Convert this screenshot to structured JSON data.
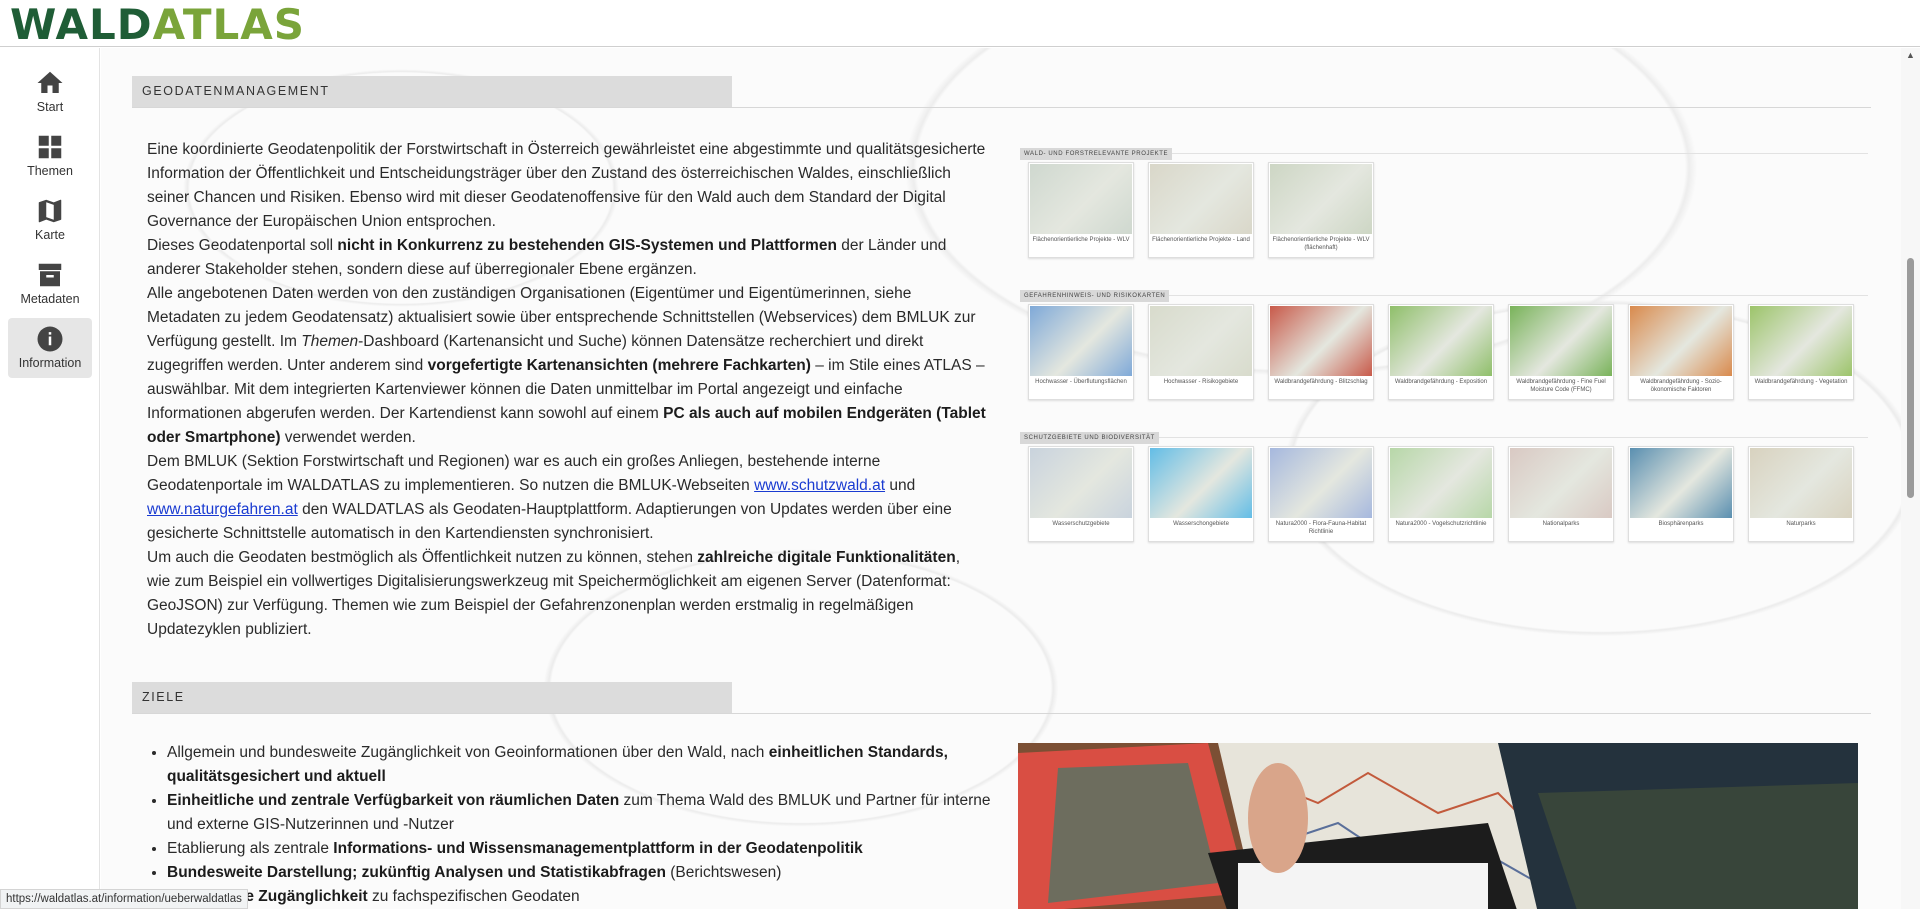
{
  "brand": {
    "logo_part1": "WALD",
    "logo_part2": "ATLAS"
  },
  "sidebar": {
    "items": [
      {
        "label": "Start",
        "icon": "home-icon"
      },
      {
        "label": "Themen",
        "icon": "grid-icon"
      },
      {
        "label": "Karte",
        "icon": "map-icon"
      },
      {
        "label": "Metadaten",
        "icon": "archive-icon"
      },
      {
        "label": "Information",
        "icon": "info-icon",
        "active": true
      }
    ]
  },
  "section1": {
    "title": "GEODATENMANAGEMENT",
    "p1_a": "Eine koordinierte Geodatenpolitik der Forstwirtschaft in Österreich gewährleistet eine abgestimmte und qualitätsgesicherte Information der Öffentlichkeit und Entscheidungsträger über den Zustand des österreichischen Waldes, einschließlich seiner Chancen und Risiken. Ebenso wird mit dieser Geodatenoffensive für den Wald auch dem Standard der Digital Governance der Europäischen Union entsprochen.",
    "p2_a": "Dieses Geodatenportal soll ",
    "p2_b": "nicht in Konkurrenz zu bestehenden GIS-Systemen und Plattformen",
    "p2_c": " der Länder und anderer Stakeholder stehen, sondern diese auf überregionaler Ebene ergänzen.",
    "p3_a": "Alle angebotenen Daten werden von den zuständigen Organisationen (Eigentümer und Eigentümerinnen, siehe Metadaten zu jedem Geodatensatz) aktualisiert sowie über entsprechende Schnittstellen (Webservices) dem BMLUK zur Verfügung gestellt. Im ",
    "p3_em": "Themen",
    "p3_b": "-Dashboard (Kartenansicht und Suche) können Datensätze recherchiert und direkt zugegriffen werden. Unter anderem sind ",
    "p3_c": "vorgefertigte Kartenansichten (mehrere Fachkarten)",
    "p3_d": " – im Stile eines ATLAS – auswählbar. Mit dem integrierten Kartenviewer können die Daten unmittelbar im Portal angezeigt und einfache Informationen abgerufen werden. Der Kartendienst kann sowohl auf einem ",
    "p3_e": "PC als auch auf mobilen Endgeräten (Tablet oder Smartphone)",
    "p3_f": " verwendet werden.",
    "p4_a": "Dem BMLUK (Sektion Forstwirtschaft und Regionen) war es auch ein großes Anliegen, bestehende interne Geodatenportale im WALDATLAS zu implementieren. So nutzen die BMLUK-Webseiten ",
    "p4_link1": "www.schutzwald.at",
    "p4_b": " und ",
    "p4_link2": "www.naturgefahren.at",
    "p4_c": " den WALDATLAS als Geodaten-Hauptplattform. Adaptierungen von Updates werden über eine gesicherte Schnittstelle automatisch in den Kartendiensten synchronisiert.",
    "p5_a": "Um auch die Geodaten bestmöglich als Öffentlichkeit nutzen zu können, stehen ",
    "p5_b": "zahlreiche digitale Funktionalitäten",
    "p5_c": ", wie zum Beispiel ein vollwertiges Digitalisierungswerkzeug mit Speichermöglichkeit am eigenen Server (Datenformat: GeoJSON) zur Verfügung. Themen wie zum Beispiel der Gefahrenzonenplan werden erstmalig in regelmäßigen Updatezyklen publiziert."
  },
  "thumb_groups": [
    {
      "title": "WALD- UND FORSTRELEVANTE PROJEKTE",
      "items": [
        {
          "caption": "Flächenorientierliche Projekte - WLV",
          "color": "#cfd8cf"
        },
        {
          "caption": "Flächenorientierliche Projekte - Land",
          "color": "#d9d7c9"
        },
        {
          "caption": "Flächenorientierliche Projekte - WLV (flächenhaft)",
          "color": "#cdd6c4"
        }
      ]
    },
    {
      "title": "GEFAHRENHINWEIS- UND RISIKOKARTEN",
      "items": [
        {
          "caption": "Hochwasser - Überflutungsflächen",
          "color": "#7fa9d8"
        },
        {
          "caption": "Hochwasser - Risikogebiete",
          "color": "#d8dbcc"
        },
        {
          "caption": "Waldbrandgefährdung - Blitzschlag",
          "color": "#c85a4a"
        },
        {
          "caption": "Waldbrandgefährdung - Exposition",
          "color": "#8fbf6a"
        },
        {
          "caption": "Waldbrandgefährdung - Fine Fuel Moisture Code (FFMC)",
          "color": "#79b35a"
        },
        {
          "caption": "Waldbrandgefährdung - Sozio-ökonomische Faktoren",
          "color": "#d98a4d"
        },
        {
          "caption": "Waldbrandgefährdung - Vegetation",
          "color": "#9cc46a"
        }
      ]
    },
    {
      "title": "SCHUTZGEBIETE UND BIODIVERSITÄT",
      "items": [
        {
          "caption": "Wasserschutzgebiete",
          "color": "#c9d3dd"
        },
        {
          "caption": "Wasserschongebiete",
          "color": "#63bde6"
        },
        {
          "caption": "Natura2000 - Flora-Fauna-Habitat Richtlinie",
          "color": "#a6b8de"
        },
        {
          "caption": "Natura2000 - Vogelschutzrichtlinie",
          "color": "#b7d7a8"
        },
        {
          "caption": "Nationalparks",
          "color": "#d9c9c3"
        },
        {
          "caption": "Biosphärenparks",
          "color": "#5a8fb0"
        },
        {
          "caption": "Naturparks",
          "color": "#d8d2bf"
        }
      ]
    }
  ],
  "section2": {
    "title": "ZIELE",
    "li1_a": "Allgemein und bundesweite Zugänglichkeit von Geoinformationen über den Wald, nach ",
    "li1_b": "einheitlichen Standards, qualitätsgesichert und aktuell",
    "li2_a": "Einheitliche und zentrale Verfügbarkeit von räumlichen Daten",
    "li2_b": " zum Thema Wald des BMLUK und Partner für interne und externe GIS-Nutzerinnen und -Nutzer",
    "li3_a": "Etablierung als zentrale ",
    "li3_b": "Informations- und Wissensmanagementplattform in der Geodatenpolitik",
    "li4_a": "Bundesweite Darstellung; zukünftig Analysen und Statistikabfragen",
    "li4_b": " (Berichtswesen)",
    "li5_a": "Einheitliche Zugänglichkeit",
    "li5_b": " zu fachspezifischen Geodaten"
  },
  "statusbar": {
    "url": "https://waldatlas.at/information/ueberwaldatlas"
  }
}
